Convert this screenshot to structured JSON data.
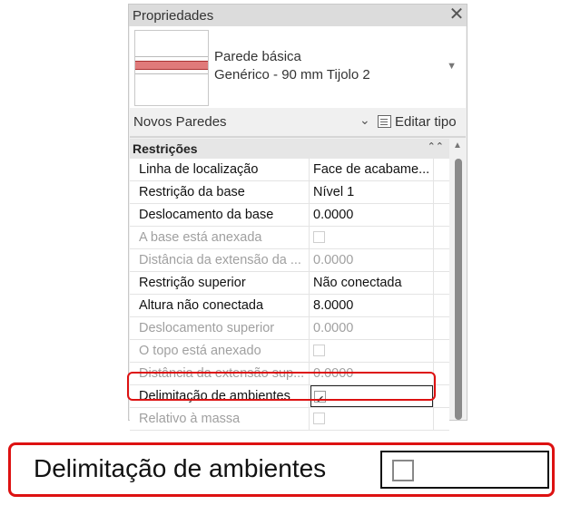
{
  "panel": {
    "title": "Propriedades",
    "close_icon": "close-icon",
    "type_name_line1": "Parede básica",
    "type_name_line2": "Genérico - 90 mm Tijolo 2",
    "instance_filter": "Novos Paredes",
    "edit_type_label": "Editar tipo",
    "section_label": "Restrições"
  },
  "rows": [
    {
      "name": "Linha de localização",
      "value": "Face de acabame...",
      "disabled": false
    },
    {
      "name": "Restrição da base",
      "value": "Nível 1",
      "disabled": false
    },
    {
      "name": "Deslocamento da base",
      "value": "0.0000",
      "disabled": false
    },
    {
      "name": "A base está anexada",
      "value": "",
      "checkbox": false,
      "disabled": true
    },
    {
      "name": "Distância da extensão da ...",
      "value": "0.0000",
      "disabled": true
    },
    {
      "name": "Restrição superior",
      "value": "Não conectada",
      "disabled": false
    },
    {
      "name": "Altura não conectada",
      "value": "8.0000",
      "disabled": false
    },
    {
      "name": "Deslocamento superior",
      "value": "0.0000",
      "disabled": true
    },
    {
      "name": "O topo está anexado",
      "value": "",
      "checkbox": false,
      "disabled": true
    },
    {
      "name": "Distância da extensão sup...",
      "value": "0.0000",
      "disabled": true
    },
    {
      "name": "Delimitação de ambientes",
      "value": "",
      "checkbox": true,
      "disabled": false
    },
    {
      "name": "Relativo à massa",
      "value": "",
      "checkbox": false,
      "disabled": true
    }
  ],
  "zoom": {
    "label": "Delimitação de ambientes",
    "checked": false
  },
  "colors": {
    "highlight": "#dd1111",
    "wall_fill": "#e07a7a"
  }
}
